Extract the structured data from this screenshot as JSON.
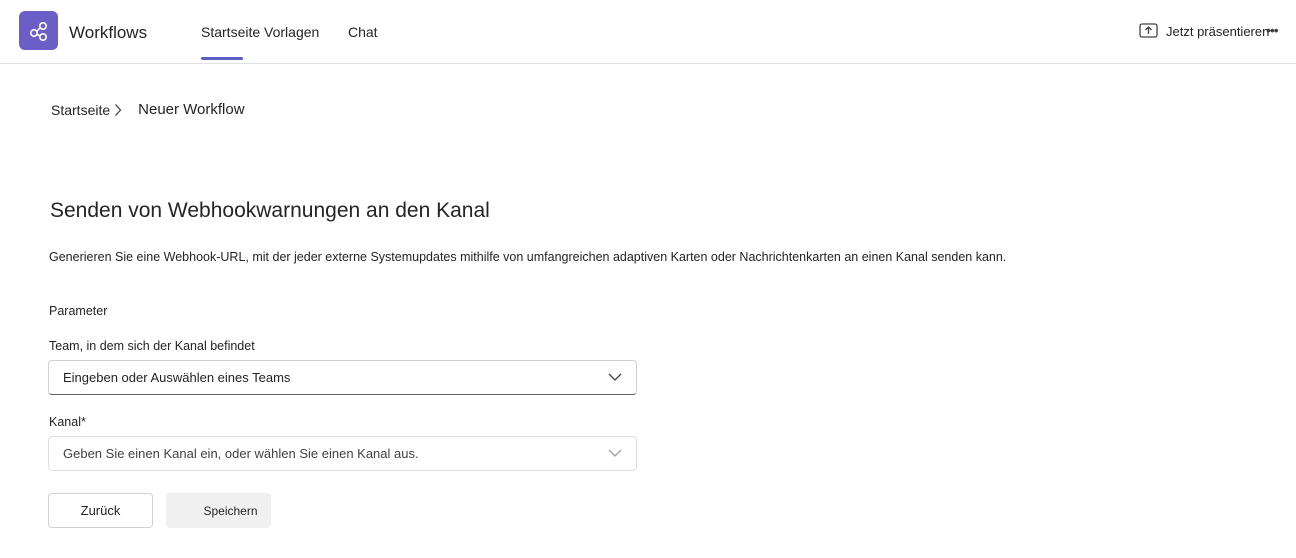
{
  "app": {
    "title": "Workflows"
  },
  "tabs": [
    {
      "label": "Startseite Vorlagen",
      "active": true
    },
    {
      "label": "Chat",
      "active": false
    }
  ],
  "header_actions": {
    "present_label": "Jetzt präsentieren",
    "more_label": "•••"
  },
  "breadcrumb": {
    "home": "Startseite",
    "current": "Neuer Workflow"
  },
  "page": {
    "title": "Senden von Webhookwarnungen an den Kanal",
    "description": "Generieren Sie eine Webhook-URL, mit der jeder externe Systemupdates mithilfe von umfangreichen adaptiven Karten oder Nachrichtenkarten an einen Kanal senden kann."
  },
  "form": {
    "section_label": "Parameter",
    "team": {
      "label": "Team, in dem sich der Kanal befindet",
      "placeholder": "Eingeben oder Auswählen eines Teams"
    },
    "channel": {
      "label": "Kanal*",
      "placeholder": "Geben Sie einen Kanal ein, oder wählen Sie einen Kanal aus."
    }
  },
  "buttons": {
    "back": "Zurück",
    "save": "Speichern"
  },
  "colors": {
    "accent": "#5b5fc7",
    "app_icon_bg": "#6b5fc7"
  },
  "icons": {
    "app": "workflow-share-icon",
    "present": "present-upload-icon",
    "chevron": "chevron-down-icon",
    "breadcrumb_sep": "chevron-right-icon"
  }
}
